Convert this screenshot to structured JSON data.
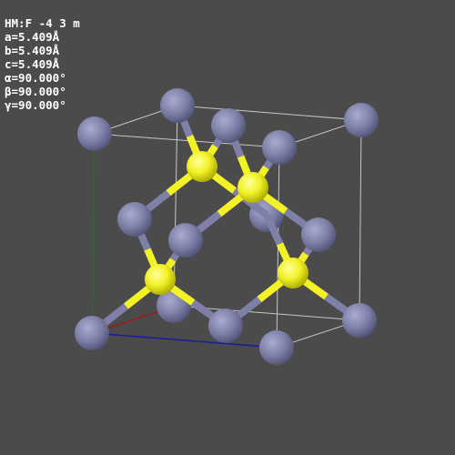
{
  "info": {
    "space_group": "HM:F -4 3 m",
    "a": "a=5.409Å",
    "b": "b=5.409Å",
    "c": "c=5.409Å",
    "alpha": "α=90.000°",
    "beta": "β=90.000°",
    "gamma": "γ=90.000°"
  },
  "colors": {
    "background": "#4b4b4b",
    "cation_atom": "#7e80a8",
    "anion_atom": "#f2f226",
    "cell_edge": "#c8c8c8",
    "axis_a": "#a01818",
    "axis_b": "#1a1aa8",
    "axis_c": "#2a6a2a"
  }
}
